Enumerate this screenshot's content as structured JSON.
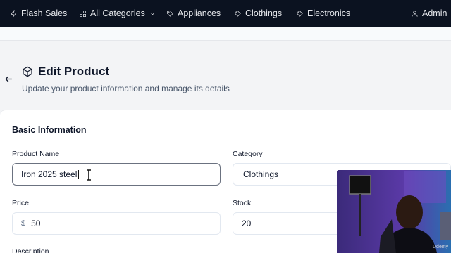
{
  "nav": {
    "flash_sales": "Flash Sales",
    "all_categories": "All Categories",
    "appliances": "Appliances",
    "clothings": "Clothings",
    "electronics": "Electronics",
    "admin": "Admin"
  },
  "header": {
    "title": "Edit Product",
    "subtitle": "Update your product information and manage its details"
  },
  "form": {
    "section_title": "Basic Information",
    "product_name_label": "Product Name",
    "product_name_value": "Iron 2025 steel",
    "category_label": "Category",
    "category_value": "Clothings",
    "price_label": "Price",
    "price_currency": "$",
    "price_value": "50",
    "stock_label": "Stock",
    "stock_value": "20",
    "description_label": "Description"
  },
  "overlay": {
    "watermark": "Udemy"
  },
  "colors": {
    "nav_bg": "#0b1220",
    "page_bg": "#f3f4f6",
    "card_bg": "#ffffff"
  }
}
